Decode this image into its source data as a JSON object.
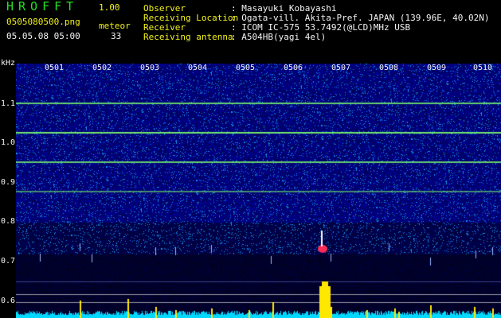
{
  "header": {
    "app_title": "HROFFT",
    "app_version": "1.00",
    "filename": "0505080500.png",
    "datetime": "05.05.08 05:00",
    "meteor_label": "meteor",
    "meteor_count": "33"
  },
  "info": {
    "rows": [
      {
        "label": "Observer",
        "value": ": Masayuki Kobayashi"
      },
      {
        "label": "Receiving Location",
        "value": ": Ogata-vill. Akita-Pref. JAPAN (139.96E, 40.02N)"
      },
      {
        "label": "Receiver",
        "value": ": ICOM IC-575 53.7492(@LCD)MHz USB"
      },
      {
        "label": "Receiving antenna",
        "value": ": A504HB(yagi 4el)"
      }
    ]
  },
  "axis": {
    "y_unit": "kHz",
    "y_ticks": [
      "1.1",
      "1.0",
      "0.9",
      "0.8",
      "0.7",
      "0.6"
    ],
    "x_ticks": [
      "0501",
      "0502",
      "0503",
      "0504",
      "0505",
      "0506",
      "0507",
      "0508",
      "0509",
      "0510"
    ]
  },
  "colors": {
    "background": "#000000",
    "spectrogram_base": "#0a1a8c",
    "tone_line": "#7cff6a",
    "meteor_echo": "#ffe800",
    "noise_floor": "#00d8ff",
    "echo_core": "#ff2a55"
  }
}
